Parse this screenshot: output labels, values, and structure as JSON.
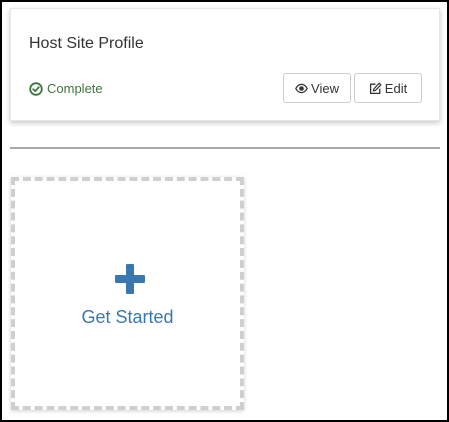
{
  "profile_card": {
    "title": "Host Site Profile",
    "status": {
      "label": "Complete",
      "icon": "check-circle-icon",
      "color": "#3c763d"
    },
    "buttons": {
      "view": {
        "label": "View",
        "icon": "eye-icon"
      },
      "edit": {
        "label": "Edit",
        "icon": "edit-icon"
      }
    }
  },
  "get_started": {
    "label": "Get Started",
    "icon": "plus-icon",
    "color": "#3a77b0"
  }
}
